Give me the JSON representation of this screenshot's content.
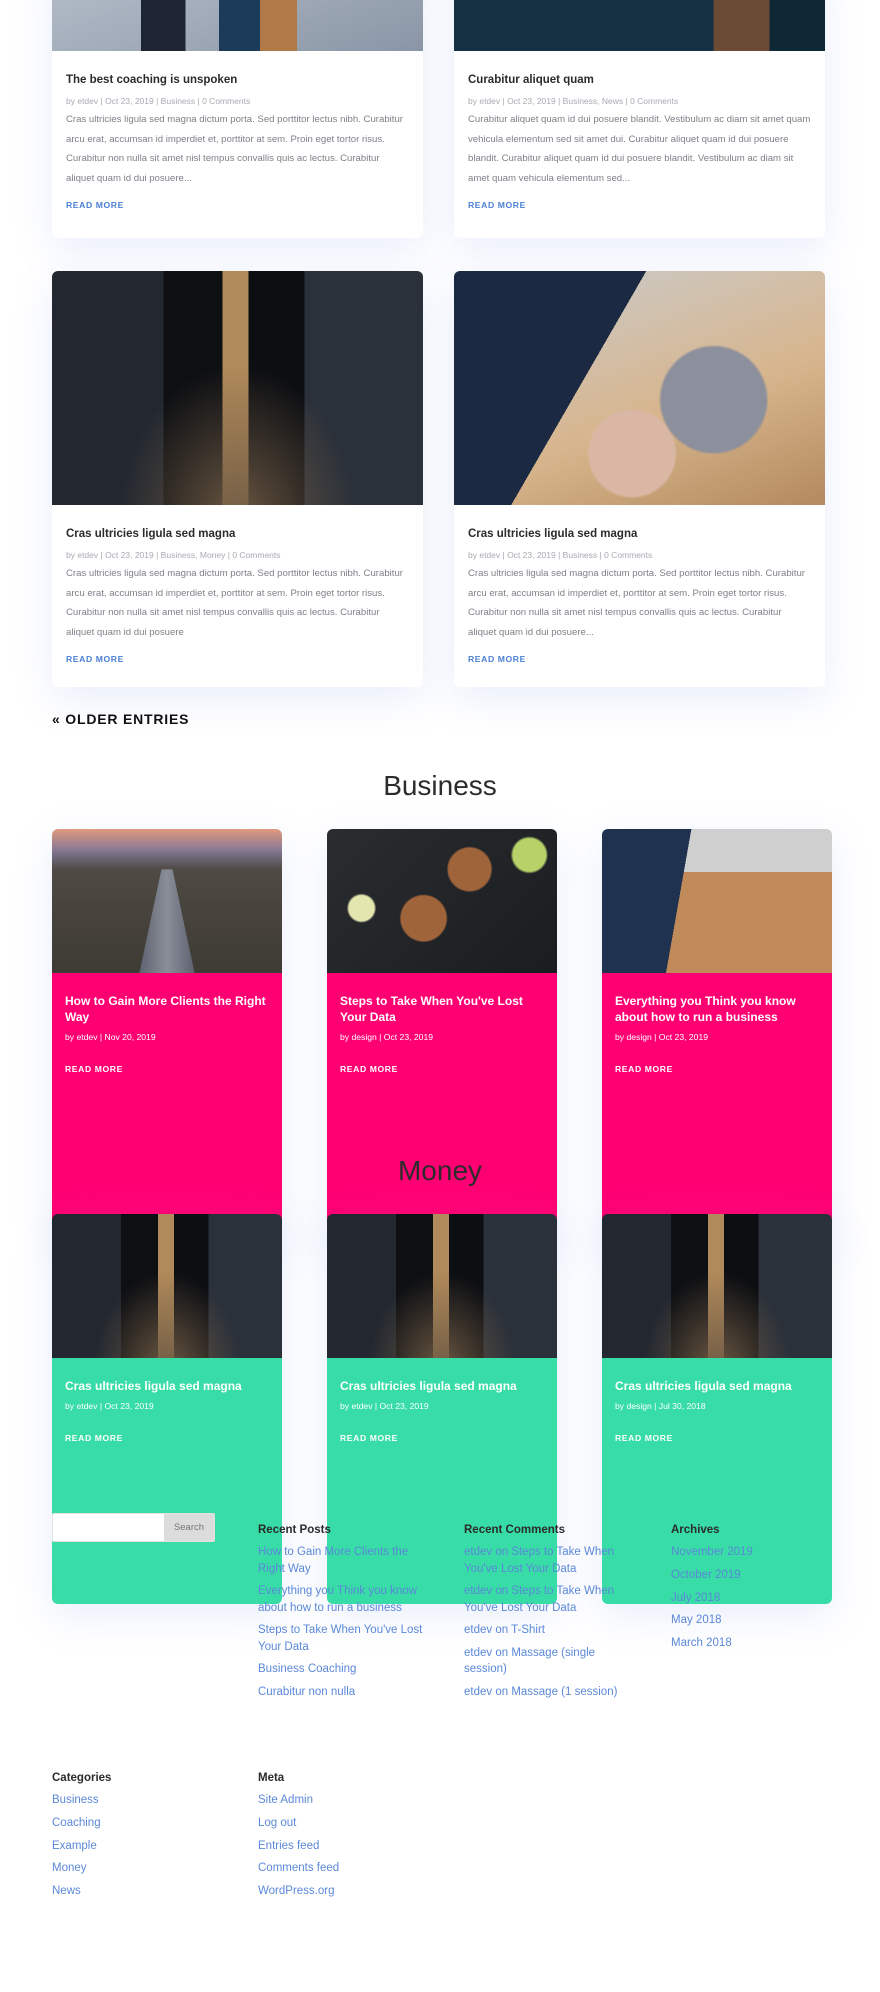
{
  "blog_posts": [
    {
      "title": "The best coaching is unspoken",
      "meta": "by etdev | Oct 23, 2019 | Business | 0 Comments",
      "excerpt": "Cras ultricies ligula sed magna dictum porta. Sed porttitor lectus nibh. Curabitur arcu erat, accumsan id imperdiet et, porttitor at sem. Proin eget tortor risus. Curabitur non nulla sit amet nisl tempus convallis quis ac lectus. Curabitur aliquet quam id dui posuere...",
      "read_more": "READ MORE",
      "image": "two-businessmen-street-photo"
    },
    {
      "title": "Curabitur aliquet quam",
      "meta": "by etdev | Oct 23, 2019 | Business, News | 0 Comments",
      "excerpt": "Curabitur aliquet quam id dui posuere blandit. Vestibulum ac diam sit amet quam vehicula elementum sed sit amet dui. Curabitur aliquet quam id dui posuere blandit. Curabitur aliquet quam id dui posuere blandit. Vestibulum ac diam sit amet quam vehicula elementum sed...",
      "read_more": "READ MORE",
      "image": "suit-closeup-photo"
    },
    {
      "title": "Cras ultricies ligula sed magna",
      "meta": "by etdev | Oct 23, 2019 | Business, Money | 0 Comments",
      "excerpt": "Cras ultricies ligula sed magna dictum porta. Sed porttitor lectus nibh. Curabitur arcu erat, accumsan id imperdiet et, porttitor at sem. Proin eget tortor risus. Curabitur non nulla sit amet nisl tempus convallis quis ac lectus. Curabitur aliquet quam id dui posuere",
      "read_more": "READ MORE",
      "image": "businessmen-hallway-photo"
    },
    {
      "title": "Cras ultricies ligula sed magna",
      "meta": "by etdev | Oct 23, 2019 | Business | 0 Comments",
      "excerpt": "Cras ultricies ligula sed magna dictum porta. Sed porttitor lectus nibh. Curabitur arcu erat, accumsan id imperdiet et, porttitor at sem. Proin eget tortor risus. Curabitur non nulla sit amet nisl tempus convallis quis ac lectus. Curabitur aliquet quam id dui posuere...",
      "read_more": "READ MORE",
      "image": "laptop-tablet-hands-photo"
    }
  ],
  "pagination": {
    "older_entries": "« OLDER ENTRIES"
  },
  "business": {
    "heading": "Business",
    "color": "#ff0073",
    "posts": [
      {
        "title": "How to Gain More Clients the Right Way",
        "meta": "by etdev | Nov 20, 2019",
        "read_more": "READ MORE",
        "image": "highway-city-photo"
      },
      {
        "title": "Steps to Take When You've Lost Your Data",
        "meta": "by design | Oct 23, 2019",
        "read_more": "READ MORE",
        "image": "drinks-ice-photo"
      },
      {
        "title": "Everything you Think you know about how to run a business",
        "meta": "by design | Oct 23, 2019",
        "read_more": "READ MORE",
        "image": "meeting-book-photo"
      }
    ]
  },
  "money": {
    "heading": "Money",
    "color": "#37dca6",
    "posts": [
      {
        "title": "Cras ultricies ligula sed magna",
        "meta": "by etdev | Oct 23, 2019",
        "read_more": "READ MORE",
        "image": "businessmen-hallway-photo"
      },
      {
        "title": "Cras ultricies ligula sed magna",
        "meta": "by etdev | Oct 23, 2019",
        "read_more": "READ MORE",
        "image": "businessmen-hallway-photo"
      },
      {
        "title": "Cras ultricies ligula sed magna",
        "meta": "by design | Jul 30, 2018",
        "read_more": "READ MORE",
        "image": "businessmen-hallway-photo"
      }
    ]
  },
  "footer": {
    "search": {
      "value": "",
      "placeholder": "",
      "button": "Search"
    },
    "recent_posts": {
      "title": "Recent Posts",
      "items": [
        "How to Gain More Clients the Right Way",
        "Everything you Think you know about how to run a business",
        "Steps to Take When You've Lost Your Data",
        "Business Coaching",
        "Curabitur non nulla"
      ]
    },
    "recent_comments": {
      "title": "Recent Comments",
      "items": [
        "etdev on Steps to Take When You've Lost Your Data",
        "etdev on Steps to Take When You've Lost Your Data",
        "etdev on T-Shirt",
        "etdev on Massage (single session)",
        "etdev on Massage (1 session)"
      ]
    },
    "archives": {
      "title": "Archives",
      "items": [
        "November 2019",
        "October 2019",
        "July 2018",
        "May 2018",
        "March 2018"
      ]
    },
    "categories": {
      "title": "Categories",
      "items": [
        "Business",
        "Coaching",
        "Example",
        "Money",
        "News"
      ]
    },
    "meta": {
      "title": "Meta",
      "items": [
        "Site Admin",
        "Log out",
        "Entries feed",
        "Comments feed",
        "WordPress.org"
      ]
    }
  },
  "colors": {
    "link": "#5b88d8",
    "read_more": "#4a7fd4",
    "business_accent": "#ff0073",
    "money_accent": "#37dca6"
  }
}
